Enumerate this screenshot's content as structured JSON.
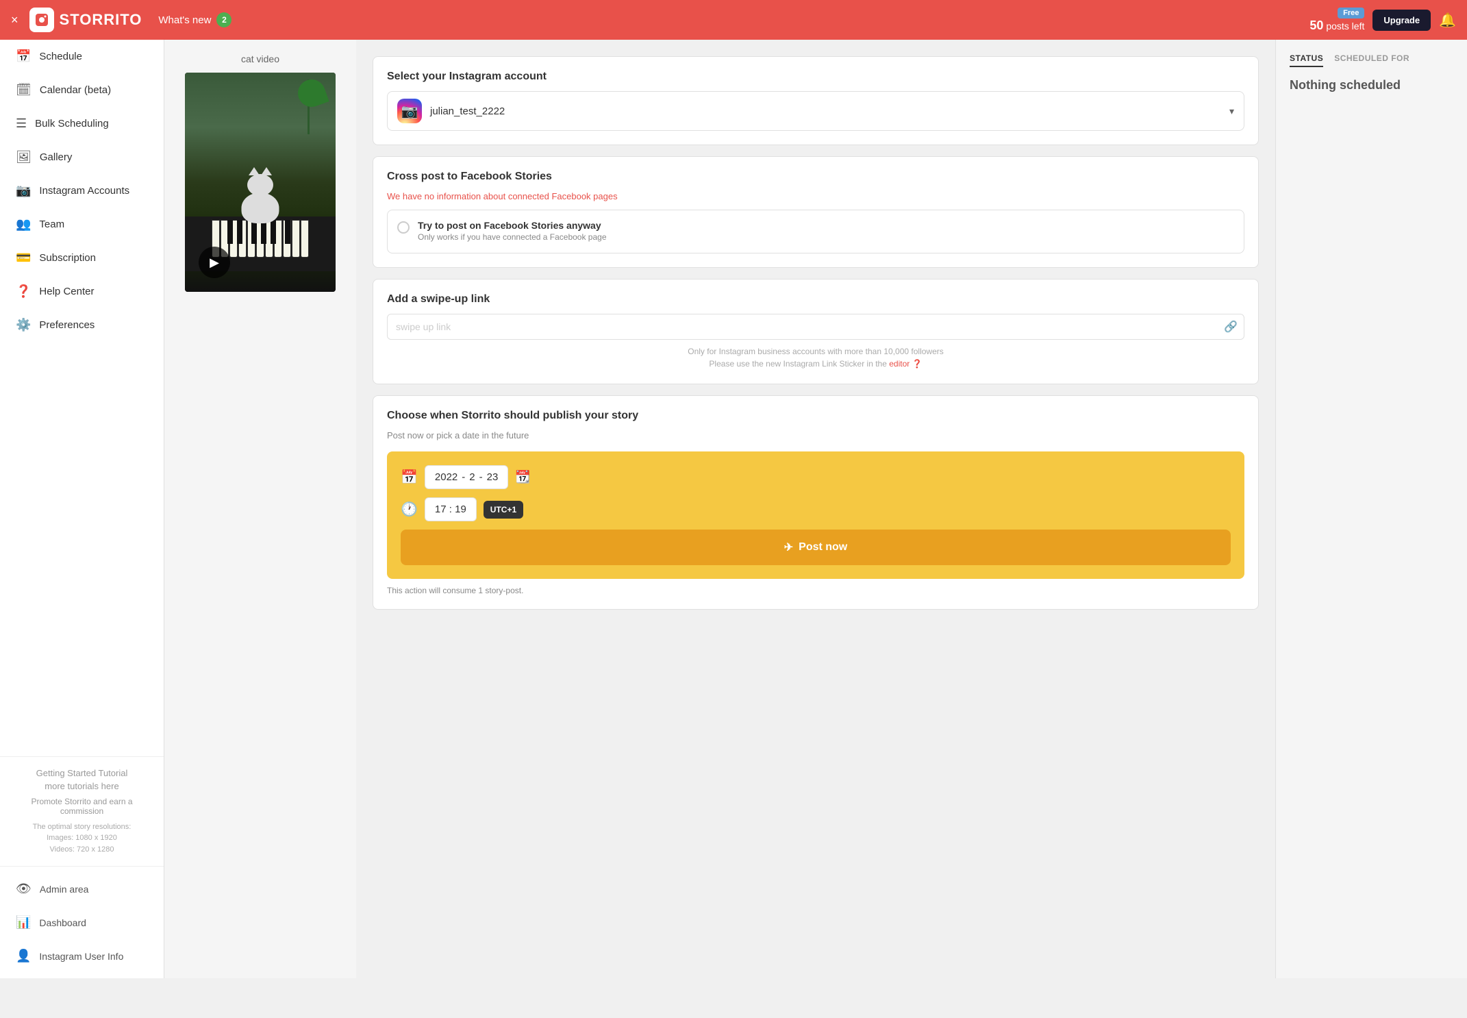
{
  "header": {
    "close_label": "×",
    "logo_text": "STORRITO",
    "whats_new_label": "What's new",
    "whats_new_badge": "2",
    "free_badge": "Free",
    "posts_left_number": "50",
    "posts_left_label": "posts left",
    "upgrade_label": "Upgrade"
  },
  "sidebar": {
    "items": [
      {
        "id": "schedule",
        "label": "Schedule",
        "icon": "📅"
      },
      {
        "id": "calendar",
        "label": "Calendar (beta)",
        "icon": "🗓"
      },
      {
        "id": "bulk",
        "label": "Bulk Scheduling",
        "icon": "☰"
      },
      {
        "id": "gallery",
        "label": "Gallery",
        "icon": "🖼"
      },
      {
        "id": "instagram",
        "label": "Instagram Accounts",
        "icon": "📷"
      },
      {
        "id": "team",
        "label": "Team",
        "icon": "👥"
      },
      {
        "id": "subscription",
        "label": "Subscription",
        "icon": "💳"
      },
      {
        "id": "help",
        "label": "Help Center",
        "icon": "❓"
      },
      {
        "id": "preferences",
        "label": "Preferences",
        "icon": "⚙️"
      }
    ],
    "tutorial_label": "Getting Started Tutorial",
    "tutorial_sub": "more tutorials here",
    "promote_label": "Promote Storrito and earn a commission",
    "resolution_title": "The optimal story resolutions:",
    "resolution_images": "Images: 1080 x 1920",
    "resolution_videos": "Videos: 720 x 1280",
    "bottom_items": [
      {
        "id": "admin",
        "label": "Admin area",
        "icon": "👁"
      },
      {
        "id": "dashboard",
        "label": "Dashboard",
        "icon": "📊"
      },
      {
        "id": "user-info",
        "label": "Instagram User Info",
        "icon": "👤"
      }
    ]
  },
  "media": {
    "title": "cat video"
  },
  "config": {
    "select_account_title": "Select your Instagram account",
    "account_name": "julian_test_2222",
    "cross_post_title": "Cross post to Facebook Stories",
    "cross_post_desc": "We have no information about",
    "cross_post_link": "connected",
    "cross_post_desc2": "Facebook pages",
    "facebook_option_label": "Try to post on Facebook Stories anyway",
    "facebook_option_sub": "Only works if you have connected a Facebook page",
    "swipe_title": "Add a swipe-up link",
    "swipe_placeholder": "swipe up link",
    "swipe_note_line1": "Only for Instagram business accounts with more than 10,000 followers",
    "swipe_note_line2": "Please use the new Instagram Link Sticker in the",
    "swipe_note_editor": "editor",
    "publish_title": "Choose when Storrito should publish your story",
    "publish_subtitle": "Post now or pick a date in the future",
    "date_year": "2022",
    "date_month": "2",
    "date_day": "23",
    "time_hour": "17",
    "time_minute": "19",
    "timezone": "UTC+1",
    "post_now_label": "Post now",
    "consume_note": "This action will consume 1 story-post."
  },
  "right_panel": {
    "tab_status": "STATUS",
    "tab_scheduled": "SCHEDULED FOR",
    "nothing_scheduled": "Nothing scheduled"
  }
}
